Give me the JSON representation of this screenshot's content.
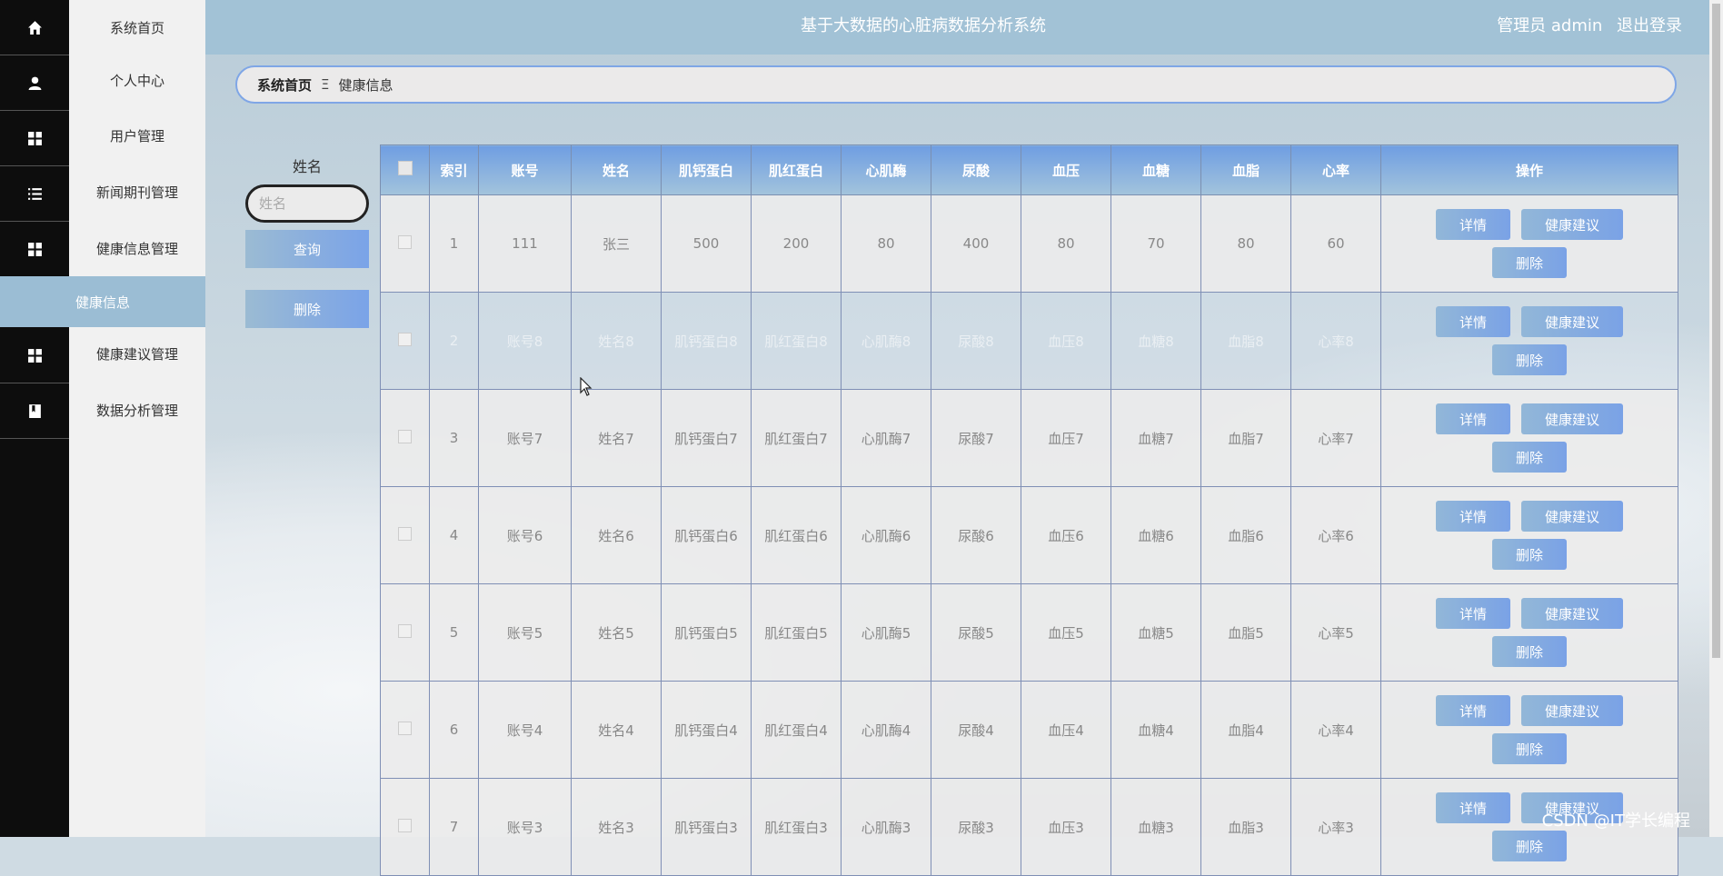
{
  "header": {
    "title": "基于大数据的心脏病数据分析系统",
    "user": "管理员 admin",
    "logout": "退出登录"
  },
  "menu": {
    "items": [
      "系统首页",
      "个人中心",
      "用户管理",
      "新闻期刊管理",
      "健康信息管理"
    ],
    "active_sub": "健康信息",
    "items_after": [
      "健康建议管理",
      "数据分析管理"
    ]
  },
  "icons": [
    "home-icon",
    "user-icon",
    "grid-icon",
    "list-icon",
    "grid-icon",
    "grid-icon",
    "book-icon"
  ],
  "breadcrumb": {
    "home": "系统首页",
    "separator": "Ξ",
    "current": "健康信息"
  },
  "search": {
    "label": "姓名",
    "placeholder": "姓名",
    "query_button": "查询",
    "delete_button": "删除"
  },
  "table": {
    "columns": [
      "",
      "索引",
      "账号",
      "姓名",
      "肌钙蛋白",
      "肌红蛋白",
      "心肌酶",
      "尿酸",
      "血压",
      "血糖",
      "血脂",
      "心率",
      "操作"
    ],
    "rows": [
      [
        "1",
        "111",
        "张三",
        "500",
        "200",
        "80",
        "400",
        "80",
        "70",
        "80",
        "60"
      ],
      [
        "2",
        "账号8",
        "姓名8",
        "肌钙蛋白8",
        "肌红蛋白8",
        "心肌酶8",
        "尿酸8",
        "血压8",
        "血糖8",
        "血脂8",
        "心率8"
      ],
      [
        "3",
        "账号7",
        "姓名7",
        "肌钙蛋白7",
        "肌红蛋白7",
        "心肌酶7",
        "尿酸7",
        "血压7",
        "血糖7",
        "血脂7",
        "心率7"
      ],
      [
        "4",
        "账号6",
        "姓名6",
        "肌钙蛋白6",
        "肌红蛋白6",
        "心肌酶6",
        "尿酸6",
        "血压6",
        "血糖6",
        "血脂6",
        "心率6"
      ],
      [
        "5",
        "账号5",
        "姓名5",
        "肌钙蛋白5",
        "肌红蛋白5",
        "心肌酶5",
        "尿酸5",
        "血压5",
        "血糖5",
        "血脂5",
        "心率5"
      ],
      [
        "6",
        "账号4",
        "姓名4",
        "肌钙蛋白4",
        "肌红蛋白4",
        "心肌酶4",
        "尿酸4",
        "血压4",
        "血糖4",
        "血脂4",
        "心率4"
      ],
      [
        "7",
        "账号3",
        "姓名3",
        "肌钙蛋白3",
        "肌红蛋白3",
        "心肌酶3",
        "尿酸3",
        "血压3",
        "血糖3",
        "血脂3",
        "心率3"
      ]
    ],
    "actions": {
      "detail": "详情",
      "advice": "健康建议",
      "delete": "删除"
    }
  },
  "watermark": "CSDN @IT学长编程"
}
